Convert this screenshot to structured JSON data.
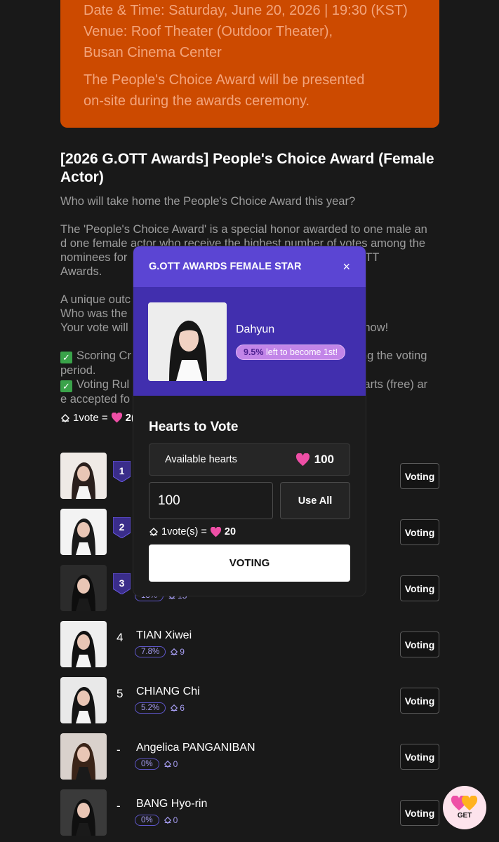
{
  "info_card": {
    "line1": "Date & Time: Saturday, June 20, 2026 | 19:30 (KST)",
    "line2": "Venue: Roof Theater (Outdoor Theater),",
    "line3": "Busan Cinema Center",
    "line4": "The People's Choice Award will be presented",
    "line5": "on-site during the awards ceremony."
  },
  "title": "[2026 G.OTT Awards] People's Choice Award (Female Actor)",
  "description": {
    "l1": "Who will take home the People's Choice Award this year?",
    "l2": "The 'People's Choice Award' is a special honor awarded to one male an",
    "l3": "d one female actor who receive the highest number of votes among the",
    "l4": "nominees for",
    "l4b": "e Global OTT",
    "l5": "Awards.",
    "l6": "A unique outc",
    "l7": "Who was the",
    "l8": "Your vote will",
    "l8b": "e now!",
    "l9": "Scoring Cr",
    "l9b": "ng the voting",
    "l10": "period.",
    "l11": "Voting Rul",
    "l11b": "earts (free) ar",
    "l12": "e accepted fo"
  },
  "rule": {
    "text": "1vote =",
    "value": "2("
  },
  "modal": {
    "header": "G.OTT AWARDS FEMALE STAR",
    "close": "×",
    "nominee": "Dahyun",
    "pill_pct": "9.5%",
    "pill_text": "left to become 1st!",
    "section_title": "Hearts to Vote",
    "available_label": "Available hearts",
    "available_value": "100",
    "input_value": "100",
    "use_all": "Use All",
    "rate_text": "1vote(s) =",
    "rate_value": "20",
    "submit": "VOTING"
  },
  "nominees": [
    {
      "rank": "1",
      "name": "",
      "pct": "",
      "votes": "",
      "badge": true
    },
    {
      "rank": "2",
      "name": "",
      "pct": "",
      "votes": "",
      "badge": true
    },
    {
      "rank": "3",
      "name": "",
      "pct": "13%",
      "votes": "15",
      "badge": true
    },
    {
      "rank": "4",
      "name": "TIAN Xiwei",
      "pct": "7.8%",
      "votes": "9",
      "badge": false
    },
    {
      "rank": "5",
      "name": "CHIANG Chi",
      "pct": "5.2%",
      "votes": "6",
      "badge": false
    },
    {
      "rank": "-",
      "name": "Angelica PANGANIBAN",
      "pct": "0%",
      "votes": "0",
      "badge": false
    },
    {
      "rank": "-",
      "name": "BANG Hyo-rin",
      "pct": "0%",
      "votes": "0",
      "badge": false
    }
  ],
  "voting_label": "Voting",
  "get_button": "GET",
  "colors": {
    "accent": "#5b45d3",
    "orange": "#cc4a00",
    "heart": "#ee4fa6"
  }
}
